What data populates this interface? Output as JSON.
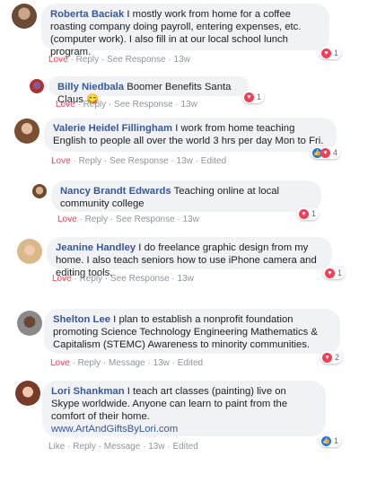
{
  "comments": [
    {
      "name": "Roberta Baciak",
      "text": "I mostly work from home for a coffee roasting company doing payroll, entering expenses, etc. (computer work). I also fill in at our local school lunch program.",
      "reaction_label": "Love",
      "reply_label": "Reply",
      "response_label": "See Response",
      "time": "13w",
      "reaction_count": "1",
      "reaction_icons": [
        "heart-icon"
      ]
    },
    {
      "name": "Billy Niedbala",
      "text": "Boomer Benefits Santa Claus",
      "emoji": "😋",
      "reaction_label": "Love",
      "reply_label": "Reply",
      "response_label": "See Response",
      "time": "13w",
      "reaction_count": "1",
      "reaction_icons": [
        "heart-icon"
      ]
    },
    {
      "name": "Valerie Heidel Fillingham",
      "text": "I work from home teaching English to people all over the world 3 hrs per day Mon to Fri.",
      "reaction_label": "Love",
      "reply_label": "Reply",
      "response_label": "See Response",
      "time": "13w",
      "edited": "Edited",
      "reaction_count": "4",
      "reaction_icons": [
        "like-icon",
        "heart-icon"
      ]
    },
    {
      "name": "Nancy Brandt Edwards",
      "text": "Teaching online at local community college",
      "reaction_label": "Love",
      "reply_label": "Reply",
      "response_label": "See Response",
      "time": "13w",
      "reaction_count": "1",
      "reaction_icons": [
        "heart-icon"
      ]
    },
    {
      "name": "Jeanine Handley",
      "text": "I do freelance graphic design from my home. I also teach seniors how to use iPhone camera and editing tools.",
      "reaction_label": "Love",
      "reply_label": "Reply",
      "response_label": "See Response",
      "time": "13w",
      "reaction_count": "1",
      "reaction_icons": [
        "heart-icon"
      ]
    },
    {
      "name": "Shelton Lee",
      "text": "I plan to establish a nonprofit foundation promoting Science Technology Engineering Mathematics & Capitalism (STEMC) Awareness to minority communities.",
      "reaction_label": "Love",
      "reply_label": "Reply",
      "response_label": "Message",
      "time": "13w",
      "edited": "Edited",
      "reaction_count": "2",
      "reaction_icons": [
        "heart-icon"
      ]
    },
    {
      "name": "Lori Shankman",
      "text": "I teach art classes (painting) live on Skype worldwide. Anyone can learn to paint from the comfort of their home.",
      "link": "www.ArtAndGiftsByLori.com",
      "reaction_label": "Like",
      "reply_label": "Reply",
      "response_label": "Message",
      "time": "13w",
      "edited": "Edited",
      "reaction_count": "1",
      "reaction_icons": [
        "like-icon"
      ]
    }
  ],
  "separator": " · ",
  "colors": {
    "love": "#f33e58",
    "like": "#1877f2",
    "name": "#385898",
    "bubble": "#f0f2f5",
    "meta": "#90949c"
  }
}
